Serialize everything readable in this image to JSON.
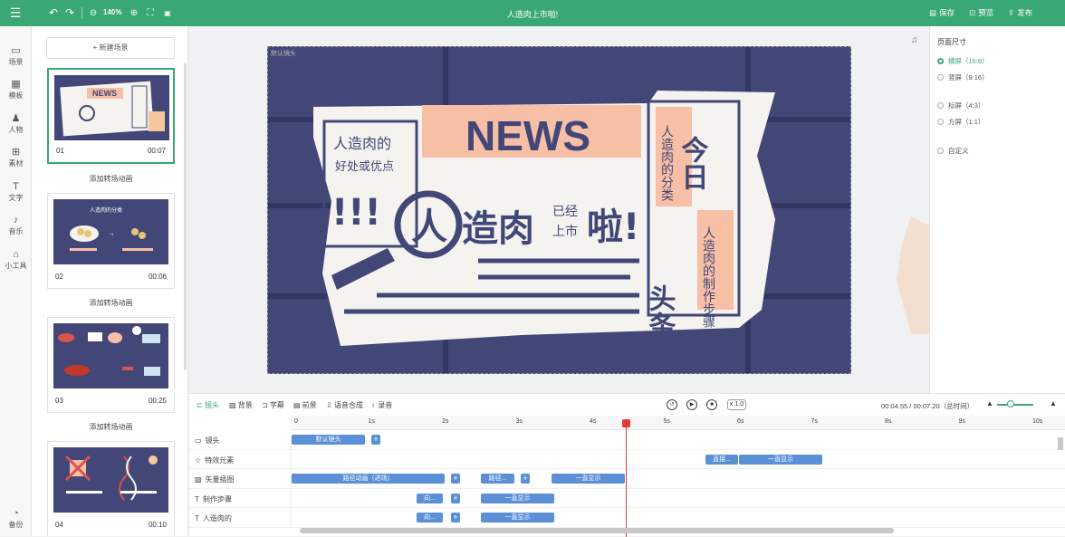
{
  "topbar": {
    "zoom": "140%",
    "title": "人造肉上市啦!",
    "save": "保存",
    "preview": "预览",
    "publish": "发布"
  },
  "leftbar": {
    "items": [
      {
        "label": "场景",
        "icon": "scene-icon"
      },
      {
        "label": "模板",
        "icon": "template-icon"
      },
      {
        "label": "人物",
        "icon": "person-icon"
      },
      {
        "label": "素材",
        "icon": "material-icon"
      },
      {
        "label": "文字",
        "icon": "text-icon"
      },
      {
        "label": "音乐",
        "icon": "music-icon"
      },
      {
        "label": "小工具",
        "icon": "tools-icon"
      }
    ],
    "backup": "备份"
  },
  "scenes": {
    "new_scene": "+ 新建场景",
    "transition_label": "添加转场动画",
    "items": [
      {
        "num": "01",
        "duration": "00:07"
      },
      {
        "num": "02",
        "duration": "00:06"
      },
      {
        "num": "03",
        "duration": "00:25"
      },
      {
        "num": "04",
        "duration": "00:10"
      }
    ],
    "thumb2_title": "人造肉的分类"
  },
  "stage": {
    "label": "默认镜头",
    "news": "NEWS",
    "headline_a": "人造肉的",
    "headline_b": "好处或优点",
    "big_a": "人",
    "big_b": "造肉",
    "big_c": "已经",
    "big_d": "上市",
    "big_e": "啦!",
    "marks": "!!!",
    "side_a": "今日",
    "side_b": "头条",
    "side_c": "人造肉的分类",
    "side_d": "人造肉的制作步骤"
  },
  "right_panel": {
    "title": "页面尺寸",
    "options": [
      {
        "label": "横屏（16:9）",
        "selected": true
      },
      {
        "label": "竖屏（9:16）",
        "selected": false
      },
      {
        "label": "标屏（4:3）",
        "selected": false
      },
      {
        "label": "方屏（1:1）",
        "selected": false
      },
      {
        "label": "自定义",
        "selected": false
      }
    ]
  },
  "timeline": {
    "tabs": [
      "镜头",
      "背景",
      "字幕",
      "前景",
      "语音合成",
      "录音"
    ],
    "speed": "x 1.0",
    "time": "00:04.55 / 00:07.20（总时间）",
    "ticks": [
      "0",
      "1s",
      "2s",
      "3s",
      "4s",
      "5s",
      "6s",
      "7s",
      "8s",
      "9s",
      "10s"
    ],
    "tracks": [
      {
        "name": "镜头",
        "clips": [
          "默认镜头"
        ]
      },
      {
        "name": "特效元素",
        "clips": [
          "直接...",
          "一直显示"
        ]
      },
      {
        "name": "矢量插图",
        "clips": [
          "路径动画（进场）",
          "路径...",
          "一直显示"
        ]
      },
      {
        "name": "制作步骤",
        "clips": [
          "向...",
          "一直显示"
        ]
      },
      {
        "name": "人造肉的",
        "clips": [
          "向...",
          "一直显示"
        ]
      }
    ]
  },
  "colors": {
    "accent": "#3aa776",
    "stage_bg": "#434777",
    "paper": "#f4f3ef",
    "pink": "#f6bfa6",
    "clip": "#5b8fd6",
    "playhead": "#e03b3b"
  }
}
